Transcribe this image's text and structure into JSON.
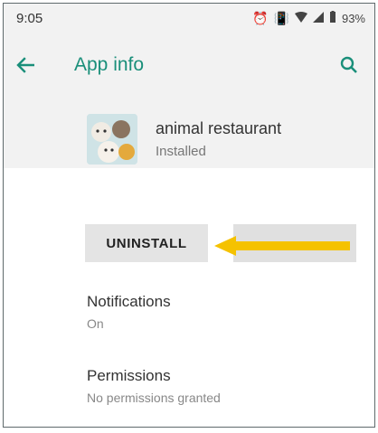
{
  "status_bar": {
    "time": "9:05",
    "battery": "93%",
    "icons": [
      "alarm-icon",
      "vibrate-icon",
      "wifi-icon",
      "signal-icon",
      "battery-icon"
    ]
  },
  "app_bar": {
    "title": "App info",
    "back_icon": "arrow-left-icon",
    "search_icon": "search-icon",
    "accent_color": "#1a8f7a"
  },
  "app": {
    "name": "animal restaurant",
    "status": "Installed"
  },
  "actions": {
    "uninstall_label": "UNINSTALL"
  },
  "annotation": {
    "arrow_color": "#f5c200",
    "points_to": "UNINSTALL"
  },
  "settings": [
    {
      "title": "Notifications",
      "subtitle": "On"
    },
    {
      "title": "Permissions",
      "subtitle": "No permissions granted"
    }
  ]
}
